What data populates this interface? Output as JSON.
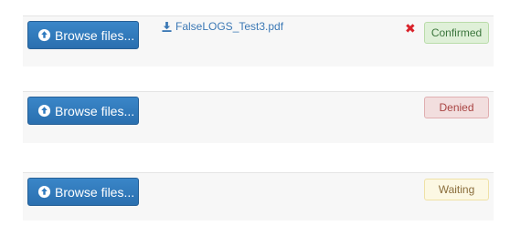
{
  "rows": [
    {
      "browse_label": "Browse files...",
      "file_name": "FalseLOGS_Test3.pdf",
      "remove_symbol": "✖",
      "status": "Confirmed"
    },
    {
      "browse_label": "Browse files...",
      "status": "Denied"
    },
    {
      "browse_label": "Browse files...",
      "status": "Waiting"
    }
  ],
  "icons": {
    "browse": "upload-circle-icon",
    "file": "download-icon",
    "remove": "close-icon"
  },
  "colors": {
    "button": "#2f7abf",
    "link": "#3b78b5",
    "remove": "#d9222a",
    "confirmed_bg": "#dff0d8",
    "denied_bg": "#f2dede",
    "waiting_bg": "#fcf8e3"
  }
}
